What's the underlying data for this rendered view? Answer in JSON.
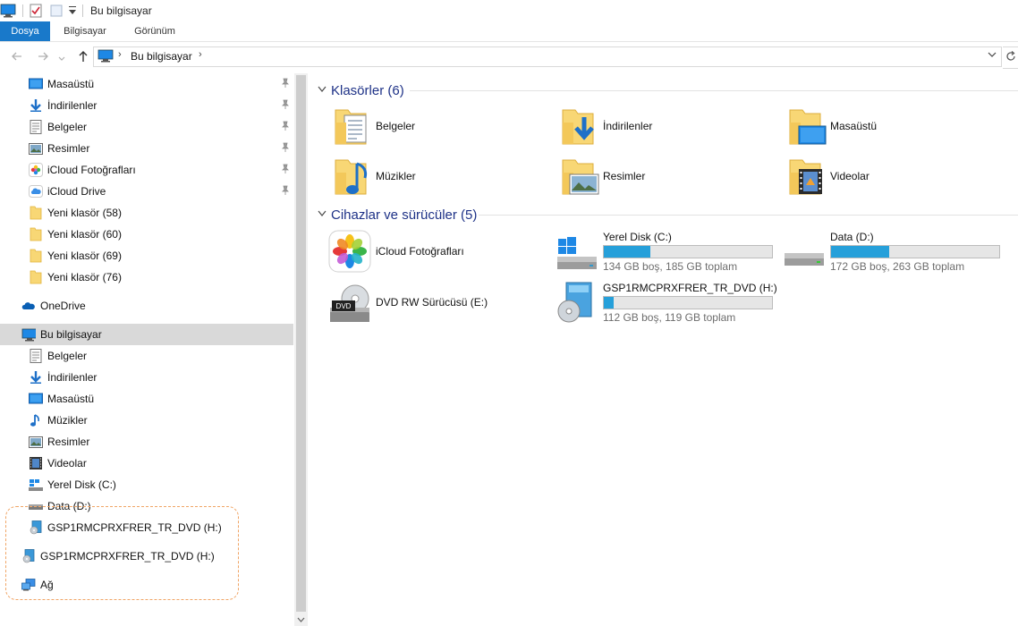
{
  "window": {
    "title": "Bu bilgisayar"
  },
  "ribbon": {
    "tabs": [
      "Dosya",
      "Bilgisayar",
      "Görünüm"
    ]
  },
  "address": {
    "crumb": "Bu bilgisayar"
  },
  "sidebar": {
    "quick_access": [
      {
        "label": "Masaüstü",
        "icon": "desktop-icon",
        "pinned": true
      },
      {
        "label": "İndirilenler",
        "icon": "download-icon",
        "pinned": true
      },
      {
        "label": "Belgeler",
        "icon": "documents-icon",
        "pinned": true
      },
      {
        "label": "Resimler",
        "icon": "pictures-icon",
        "pinned": true
      },
      {
        "label": "iCloud Fotoğrafları",
        "icon": "icloud-photos-icon",
        "pinned": true
      },
      {
        "label": "iCloud Drive",
        "icon": "icloud-drive-icon",
        "pinned": true
      },
      {
        "label": "Yeni klasör (58)",
        "icon": "folder-icon",
        "pinned": false
      },
      {
        "label": "Yeni klasör (60)",
        "icon": "folder-icon",
        "pinned": false
      },
      {
        "label": "Yeni klasör (69)",
        "icon": "folder-icon",
        "pinned": false
      },
      {
        "label": "Yeni klasör (76)",
        "icon": "folder-icon",
        "pinned": false
      }
    ],
    "onedrive": "OneDrive",
    "this_pc": "Bu bilgisayar",
    "pc_items": [
      {
        "label": "Belgeler",
        "icon": "documents-icon"
      },
      {
        "label": "İndirilenler",
        "icon": "download-icon"
      },
      {
        "label": "Masaüstü",
        "icon": "desktop-icon"
      },
      {
        "label": "Müzikler",
        "icon": "music-icon"
      },
      {
        "label": "Resimler",
        "icon": "pictures-icon"
      },
      {
        "label": "Videolar",
        "icon": "videos-icon"
      },
      {
        "label": "Yerel Disk (C:)",
        "icon": "windows-drive-icon"
      },
      {
        "label": "Data (D:)",
        "icon": "drive-icon"
      },
      {
        "label": "GSP1RMCPRXFRER_TR_DVD (H:)",
        "icon": "dvd-drive-icon"
      }
    ],
    "dvd_root": "GSP1RMCPRXFRER_TR_DVD (H:)",
    "network": "Ağ"
  },
  "content": {
    "folders_header": "Klasörler (6)",
    "folders": [
      {
        "label": "Belgeler",
        "icon": "documents-folder-icon"
      },
      {
        "label": "İndirilenler",
        "icon": "downloads-folder-icon"
      },
      {
        "label": "Masaüstü",
        "icon": "desktop-folder-icon"
      },
      {
        "label": "Müzikler",
        "icon": "music-folder-icon"
      },
      {
        "label": "Resimler",
        "icon": "pictures-folder-icon"
      },
      {
        "label": "Videolar",
        "icon": "videos-folder-icon"
      }
    ],
    "devices_header": "Cihazlar ve sürücüler (5)",
    "devices": {
      "icloud": {
        "label": "iCloud Fotoğrafları"
      },
      "c": {
        "label": "Yerel Disk (C:)",
        "sub": "134 GB boş, 185 GB toplam",
        "used_fraction": 0.276
      },
      "d": {
        "label": "Data (D:)",
        "sub": "172 GB boş, 263 GB toplam",
        "used_fraction": 0.346
      },
      "dvd": {
        "label": "DVD RW Sürücüsü (E:)"
      },
      "h": {
        "label": "GSP1RMCPRXFRER_TR_DVD (H:)",
        "sub": "112 GB boş, 119 GB toplam",
        "used_fraction": 0.059
      }
    }
  },
  "colors": {
    "accent": "#1979ca",
    "bar_fill": "#26a0da",
    "selection": "#d9d9d9",
    "annotation": "#f0a566",
    "header_text": "#1e3287"
  }
}
